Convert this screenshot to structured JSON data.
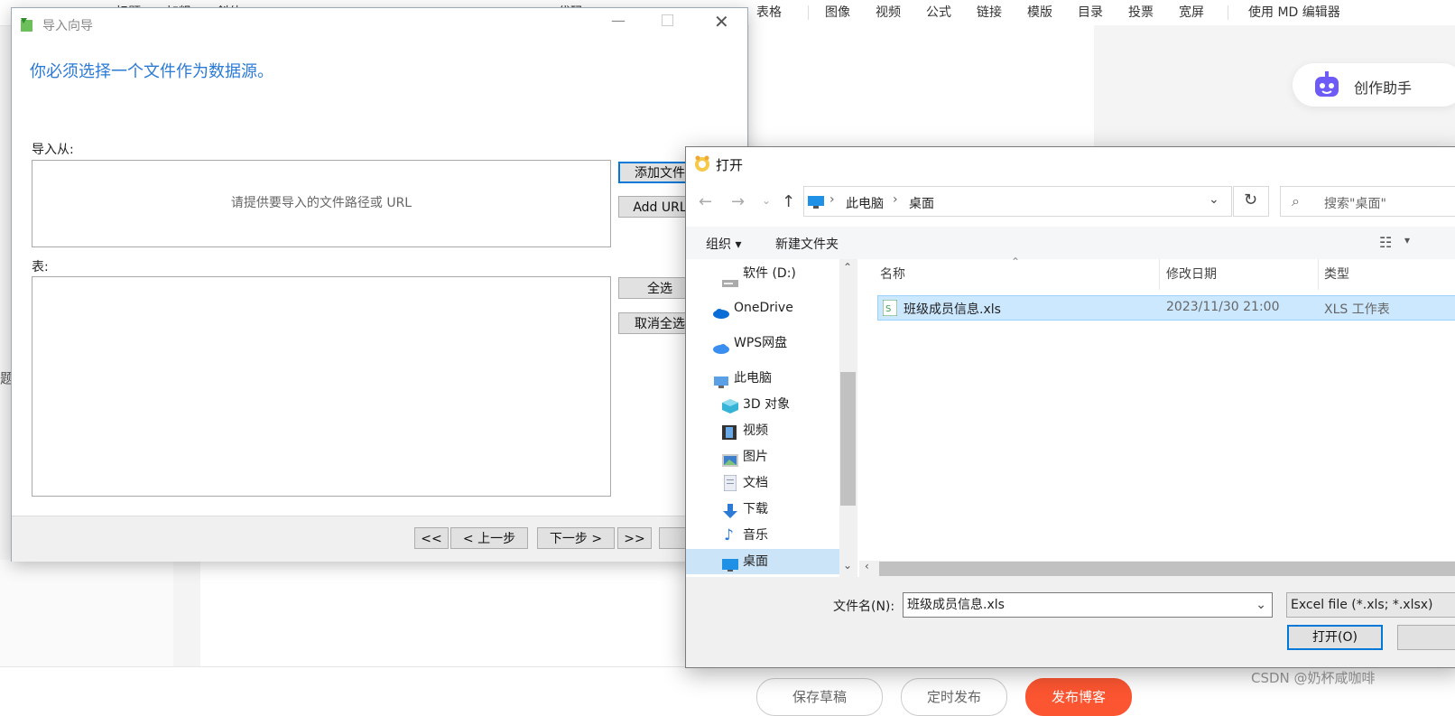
{
  "background": {
    "toolbar": [
      "标题",
      "加粗",
      "斜体",
      "代码",
      "表格",
      "图像",
      "视频",
      "公式",
      "链接",
      "模版",
      "目录",
      "投票",
      "宽屏",
      "使用 MD 编辑器"
    ],
    "left_edge_text": "题",
    "assistant_label": "创作助手",
    "bottom_buttons": [
      "保存草稿",
      "定时发布",
      "发布博客"
    ],
    "watermark": "CSDN @奶杯咸咖啡",
    "accent_color": "#fc5531"
  },
  "wizard": {
    "title": "导入向导",
    "heading": "你必须选择一个文件作为数据源。",
    "import_from_label": "导入从:",
    "path_placeholder": "请提供要导入的文件路径或 URL",
    "add_file_button": "添加文件",
    "add_url_button": "Add URL",
    "table_label": "表:",
    "select_all_button": "全选",
    "deselect_all_button": "取消全选",
    "nav": {
      "first": "<<",
      "prev": "< 上一步",
      "next": "下一步 >",
      "last": ">>"
    },
    "heading_color": "#2a7ad6"
  },
  "open_dialog": {
    "title": "打开",
    "breadcrumb": [
      "此电脑",
      "桌面"
    ],
    "search_placeholder": "搜索\"桌面\"",
    "organize": "组织",
    "new_folder": "新建文件夹",
    "tree": [
      {
        "label": "软件 (D:)",
        "icon": "drive-icon",
        "selected": false
      },
      {
        "label": "OneDrive",
        "icon": "cloud-icon",
        "selected": false
      },
      {
        "label": "WPS网盘",
        "icon": "wps-cloud-icon",
        "selected": false
      },
      {
        "label": "此电脑",
        "icon": "pc-icon",
        "selected": false
      },
      {
        "label": "3D 对象",
        "icon": "cube-icon",
        "selected": false
      },
      {
        "label": "视频",
        "icon": "film-icon",
        "selected": false
      },
      {
        "label": "图片",
        "icon": "picture-icon",
        "selected": false
      },
      {
        "label": "文档",
        "icon": "document-icon",
        "selected": false
      },
      {
        "label": "下载",
        "icon": "download-icon",
        "selected": false
      },
      {
        "label": "音乐",
        "icon": "music-icon",
        "selected": false
      },
      {
        "label": "桌面",
        "icon": "desktop-icon",
        "selected": true
      }
    ],
    "columns": [
      "名称",
      "修改日期",
      "类型"
    ],
    "files": [
      {
        "name": "班级成员信息.xls",
        "modified": "2023/11/30 21:00",
        "type": "XLS 工作表"
      }
    ],
    "filename_label": "文件名(N):",
    "filename_value": "班级成员信息.xls",
    "filter_value": "Excel file (*.xls; *.xlsx)",
    "open_button": "打开(O)",
    "selection_color": "#cce8ff"
  }
}
